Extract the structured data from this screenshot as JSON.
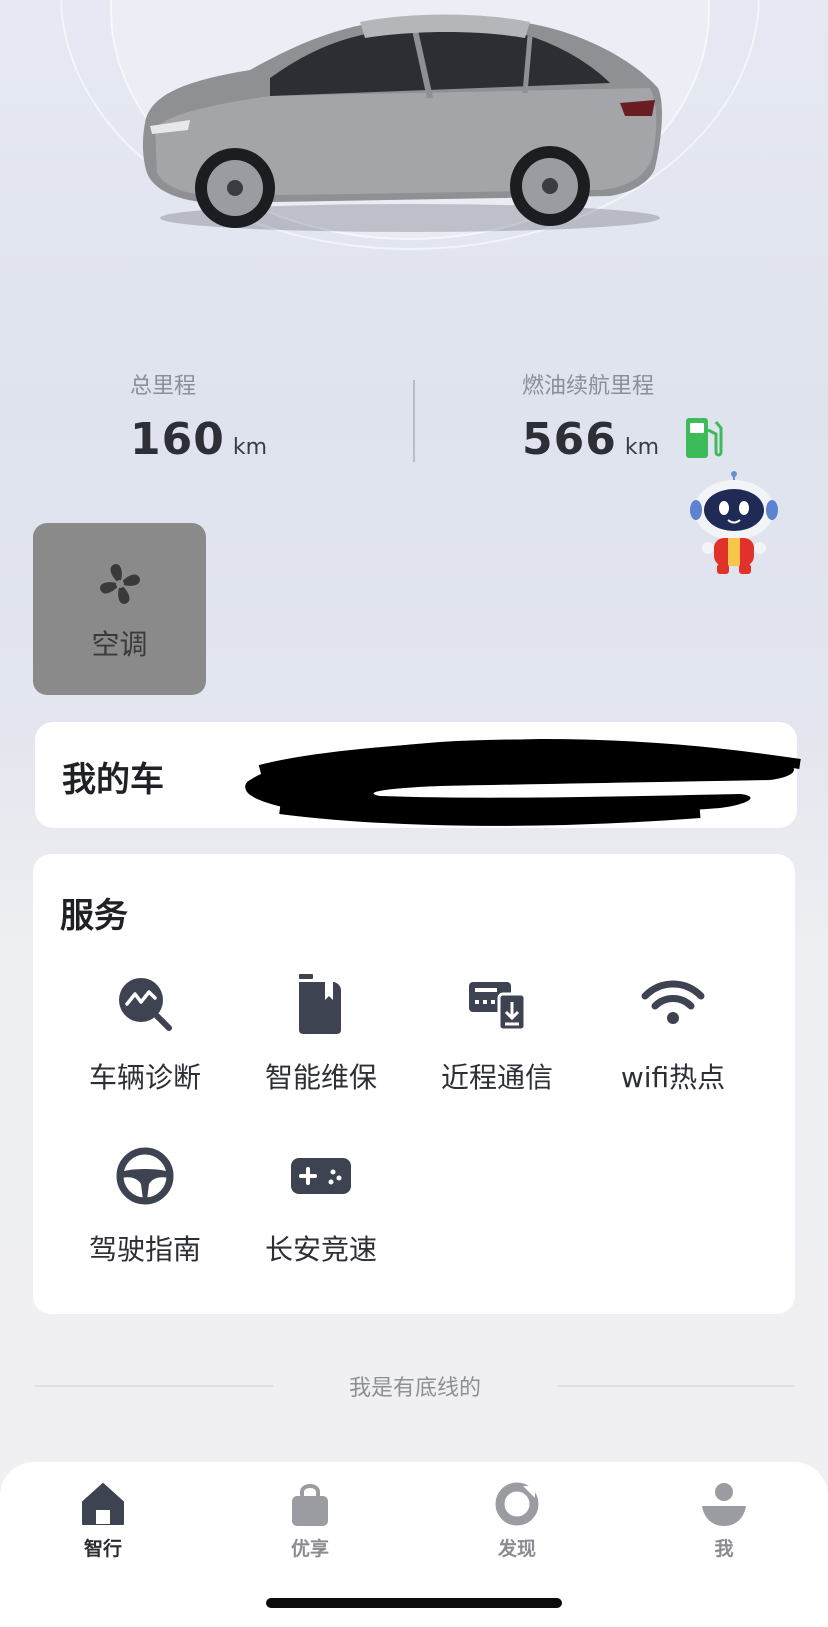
{
  "stats": {
    "total_mileage": {
      "label": "总里程",
      "value": "160",
      "unit": "km"
    },
    "fuel_range": {
      "label": "燃油续航里程",
      "value": "566",
      "unit": "km",
      "icon": "fuel-pump-icon"
    }
  },
  "quick_controls": {
    "ac": {
      "label": "空调",
      "icon": "fan-icon"
    }
  },
  "my_car": {
    "title": "我的车"
  },
  "services": {
    "title": "服务",
    "items": [
      {
        "label": "车辆诊断",
        "icon": "diagnosis-icon"
      },
      {
        "label": "智能维保",
        "icon": "maintenance-icon"
      },
      {
        "label": "近程通信",
        "icon": "near-communication-icon"
      },
      {
        "label": "wifi热点",
        "icon": "wifi-icon"
      },
      {
        "label": "驾驶指南",
        "icon": "steering-wheel-icon"
      },
      {
        "label": "长安竞速",
        "icon": "gamepad-icon"
      }
    ]
  },
  "footer_text": "我是有底线的",
  "tabbar": {
    "tabs": [
      {
        "label": "智行",
        "icon": "home-icon",
        "active": true
      },
      {
        "label": "优享",
        "icon": "bag-icon",
        "active": false
      },
      {
        "label": "发现",
        "icon": "discover-icon",
        "active": false
      },
      {
        "label": "我",
        "icon": "user-icon",
        "active": false
      }
    ]
  },
  "colors": {
    "fuel_green": "#3dbb5b",
    "icon_dark": "#3d4350",
    "ac_tile": "#8a8a8a"
  }
}
